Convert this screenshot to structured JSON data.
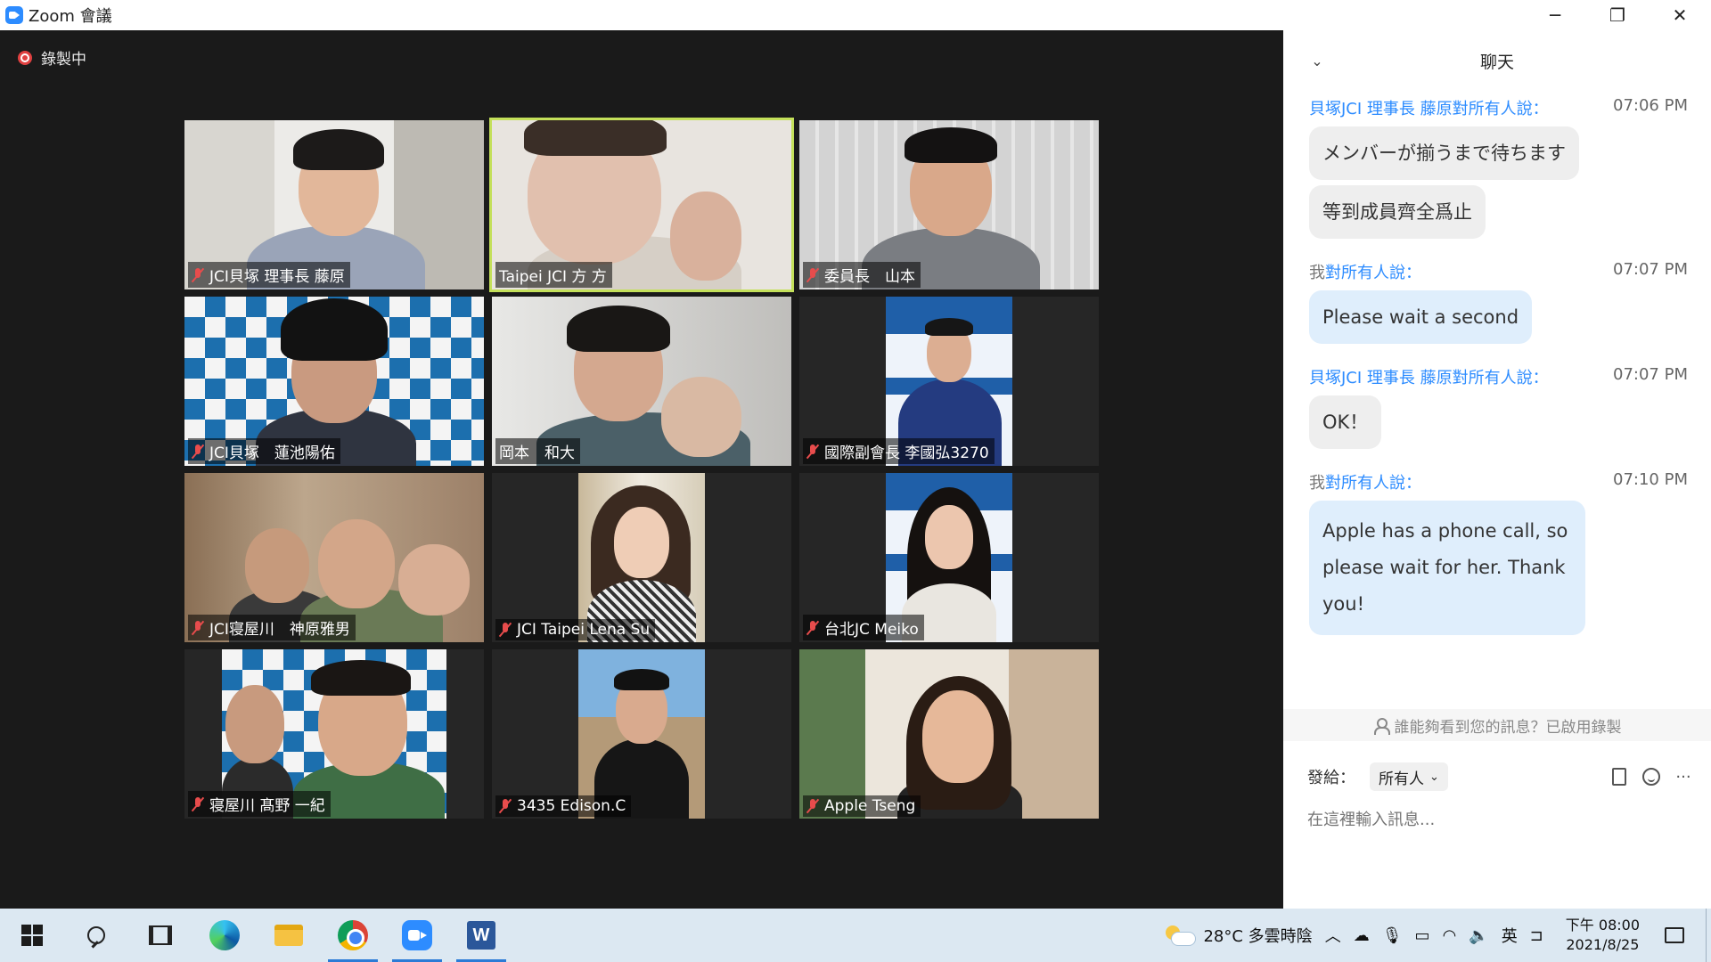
{
  "window": {
    "title": "Zoom 會議",
    "minimize": "─",
    "restore": "❐",
    "close": "✕"
  },
  "meeting": {
    "recording_label": "錄製中",
    "participants": [
      {
        "name": "JCI貝塚 理事長 藤原",
        "muted": true,
        "active": false
      },
      {
        "name": "Taipei JCI 方 方",
        "muted": false,
        "active": true
      },
      {
        "name": "委員長　山本",
        "muted": true,
        "active": false
      },
      {
        "name": "JCI貝塚　蓮池陽佑",
        "muted": true,
        "active": false
      },
      {
        "name": "岡本　和大",
        "muted": false,
        "active": false
      },
      {
        "name": "國際副會長 李國弘3270",
        "muted": true,
        "active": false
      },
      {
        "name": "JCI寝屋川　神原雅男",
        "muted": true,
        "active": false
      },
      {
        "name": "JCI Taipei Lena Su",
        "muted": true,
        "active": false
      },
      {
        "name": "台北JC Meiko",
        "muted": true,
        "active": false
      },
      {
        "name": "寝屋川 髙野 一紀",
        "muted": true,
        "active": false
      },
      {
        "name": "3435 Edison.C",
        "muted": true,
        "active": false
      },
      {
        "name": "Apple Tseng",
        "muted": true,
        "active": false
      }
    ]
  },
  "chat": {
    "title": "聊天",
    "messages": [
      {
        "sender": "貝塚JCI 理事長 藤原",
        "suffix": "對所有人說：",
        "time": "07:06 PM",
        "bubbles": [
          "メンバーが揃うまで待ちます",
          "等到成員齊全爲止"
        ]
      },
      {
        "sender": "我",
        "suffix": "對所有人說：",
        "time": "07:07 PM",
        "bubbles": [
          "Please wait a second"
        ]
      },
      {
        "sender": "貝塚JCI 理事長 藤原",
        "suffix": "對所有人說：",
        "time": "07:07 PM",
        "bubbles": [
          "OK！"
        ]
      },
      {
        "sender": "我",
        "suffix": "對所有人說：",
        "time": "07:10 PM",
        "bubbles": [
          "Apple has a phone call, so please wait for her. Thank you!"
        ]
      }
    ],
    "notice": "誰能夠看到您的訊息？已啟用錄製",
    "send_to_label": "發給：",
    "send_to_value": "所有人",
    "input_placeholder": "在這裡輸入訊息...",
    "more": "···"
  },
  "taskbar": {
    "weather": "28°C  多雲時陰",
    "ime": "英",
    "time": "下午 08:00",
    "date": "2021/8/25"
  },
  "colors": {
    "zoom_blue": "#2d8cff",
    "active_speaker": "#c4e05a",
    "mic_muted": "#e84c4c"
  }
}
